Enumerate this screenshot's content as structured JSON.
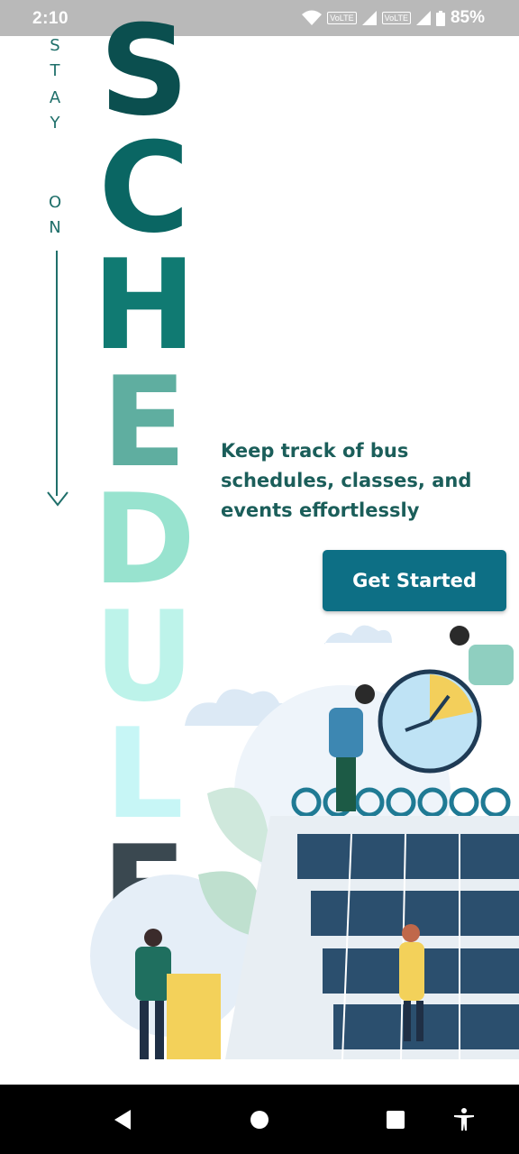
{
  "status_bar": {
    "time": "2:10",
    "network_tag_1": "VoLTE",
    "network_tag_2": "VoLTE",
    "battery_percent": "85%"
  },
  "hero": {
    "side_text_letters": [
      "S",
      "T",
      "A",
      "Y",
      "O",
      "N"
    ],
    "title_letters": [
      {
        "char": "S",
        "color": "#0b4f4f"
      },
      {
        "char": "C",
        "color": "#0a6663"
      },
      {
        "char": "H",
        "color": "#107a72"
      },
      {
        "char": "E",
        "color": "#5faea0"
      },
      {
        "char": "D",
        "color": "#98e3cf"
      },
      {
        "char": "U",
        "color": "#bdf3ea"
      },
      {
        "char": "L",
        "color": "#c7f6f6"
      },
      {
        "char": "E",
        "color": "#3a4850"
      }
    ],
    "tagline": "Keep track of bus schedules, classes, and events effortlessly",
    "cta_label": "Get Started"
  },
  "colors": {
    "primary": "#0d6f85",
    "tagline": "#1b5e5a"
  },
  "nav_bar": {
    "icons": [
      "back-icon",
      "home-icon",
      "recents-icon",
      "accessibility-icon"
    ]
  }
}
